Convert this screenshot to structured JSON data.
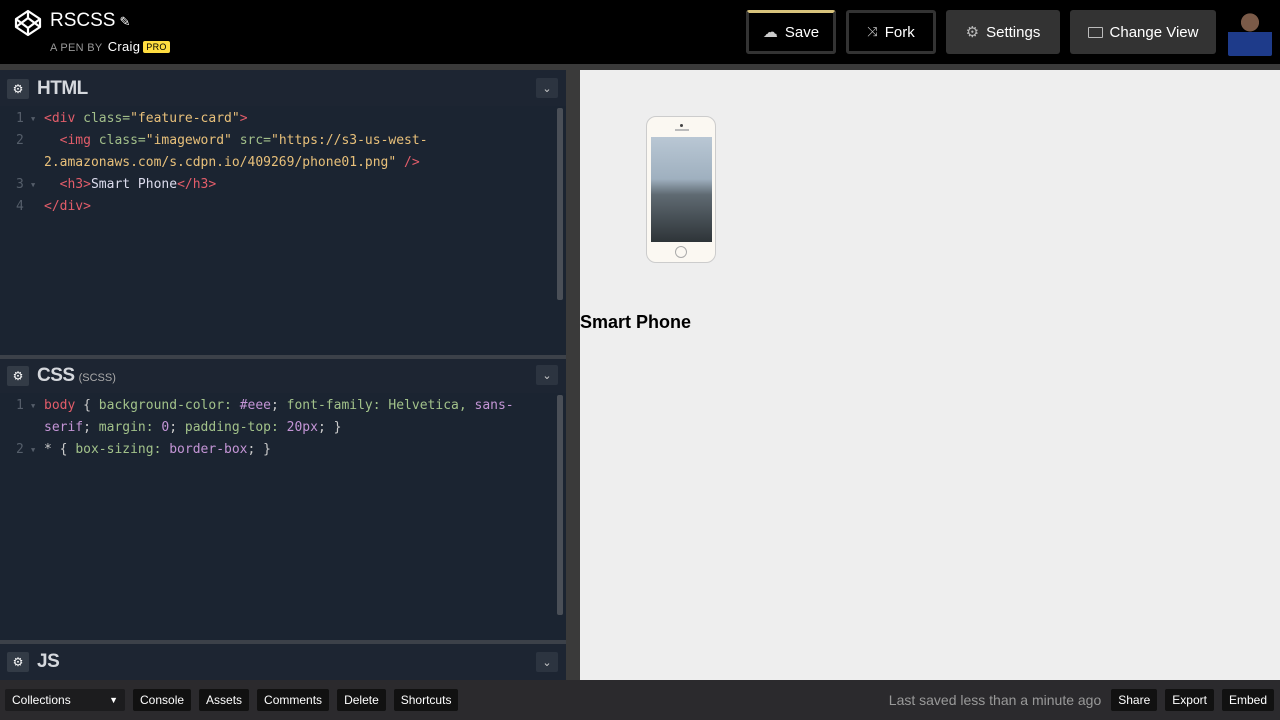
{
  "header": {
    "title": "RSCSS",
    "byline": "A PEN BY",
    "author": "Craig",
    "badge": "PRO",
    "buttons": {
      "save": "Save",
      "fork": "Fork",
      "settings": "Settings",
      "change_view": "Change View"
    }
  },
  "panels": {
    "html": {
      "title": "HTML",
      "lines": [
        {
          "n": "1",
          "fold": true,
          "tokens": [
            [
              "t-tag",
              "<div "
            ],
            [
              "t-attr",
              "class="
            ],
            [
              "t-str",
              "\"feature-card\""
            ],
            [
              "t-tag",
              ">"
            ]
          ]
        },
        {
          "n": "2",
          "fold": false,
          "tokens": [
            [
              "t-tag",
              "  <img "
            ],
            [
              "t-attr",
              "class="
            ],
            [
              "t-str",
              "\"imageword\" "
            ],
            [
              "t-attr",
              "src="
            ],
            [
              "t-str",
              "\"https://s3-us-west-"
            ]
          ]
        },
        {
          "n": "",
          "fold": false,
          "tokens": [
            [
              "t-str",
              "2.amazonaws.com/s.cdpn.io/409269/phone01.png\" "
            ],
            [
              "t-tag",
              "/>"
            ]
          ]
        },
        {
          "n": "3",
          "fold": true,
          "tokens": [
            [
              "t-tag",
              "  <h3>"
            ],
            [
              "t-text",
              "Smart Phone"
            ],
            [
              "t-tag",
              "</h3>"
            ]
          ]
        },
        {
          "n": "4",
          "fold": false,
          "tokens": [
            [
              "t-tag",
              "</div>"
            ]
          ]
        }
      ]
    },
    "css": {
      "title": "CSS",
      "subtitle": "(SCSS)",
      "lines": [
        {
          "n": "1",
          "fold": true,
          "tokens": [
            [
              "t-sel",
              "body "
            ],
            [
              "t-punc",
              "{ "
            ],
            [
              "t-prop",
              "background-color: "
            ],
            [
              "t-val",
              "#eee"
            ],
            [
              "t-punc",
              "; "
            ],
            [
              "t-prop",
              "font-family: Helvetica, "
            ],
            [
              "t-val",
              "sans-"
            ]
          ]
        },
        {
          "n": "",
          "fold": false,
          "tokens": [
            [
              "t-val",
              "serif"
            ],
            [
              "t-punc",
              "; "
            ],
            [
              "t-prop",
              "margin: "
            ],
            [
              "t-val",
              "0"
            ],
            [
              "t-punc",
              "; "
            ],
            [
              "t-prop",
              "padding-top: "
            ],
            [
              "t-val",
              "20px"
            ],
            [
              "t-punc",
              "; }"
            ]
          ]
        },
        {
          "n": "2",
          "fold": true,
          "tokens": [
            [
              "t-punc",
              "* { "
            ],
            [
              "t-prop",
              "box-sizing: "
            ],
            [
              "t-val",
              "border-box"
            ],
            [
              "t-punc",
              "; }"
            ]
          ]
        }
      ]
    },
    "js": {
      "title": "JS"
    }
  },
  "preview": {
    "heading": "Smart Phone"
  },
  "footer": {
    "collections": "Collections",
    "buttons": [
      "Console",
      "Assets",
      "Comments",
      "Delete",
      "Shortcuts"
    ],
    "status": "Last saved less than a minute ago",
    "right_buttons": [
      "Share",
      "Export",
      "Embed"
    ]
  }
}
